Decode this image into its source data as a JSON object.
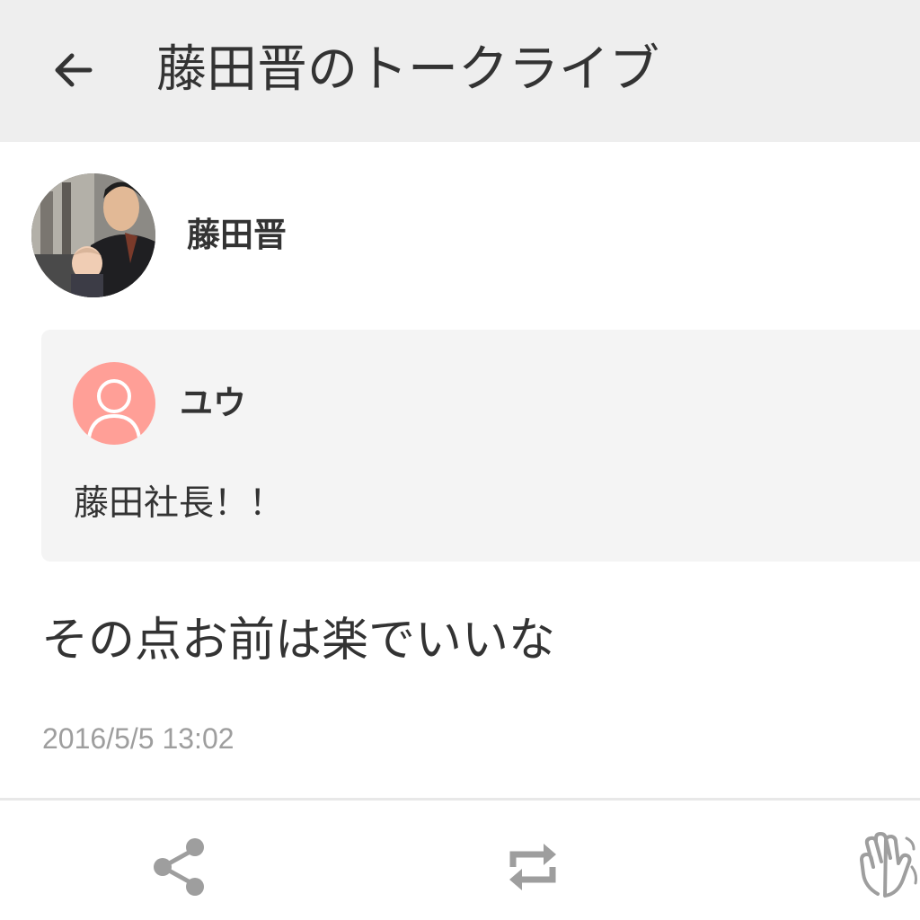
{
  "header": {
    "back_icon": "arrow-left-icon",
    "title": "藤田晋のトークライブ"
  },
  "post": {
    "author": {
      "name": "藤田晋",
      "avatar": "profile-photo"
    },
    "quote": {
      "user_name": "ユウ",
      "avatar_icon": "default-user-icon",
      "avatar_color": "#ff9f97",
      "text": "藤田社長！！"
    },
    "message": "その点お前は楽でいいな",
    "timestamp": "2016/5/5 13:02"
  },
  "actions": [
    {
      "icon": "share-icon"
    },
    {
      "icon": "repost-icon"
    },
    {
      "icon": "clap-icon"
    }
  ],
  "colors": {
    "header_bg": "#eeeeee",
    "card_bg": "#f4f4f4",
    "text": "#333333",
    "muted": "#9e9e9e",
    "icon": "#9e9e9e"
  }
}
